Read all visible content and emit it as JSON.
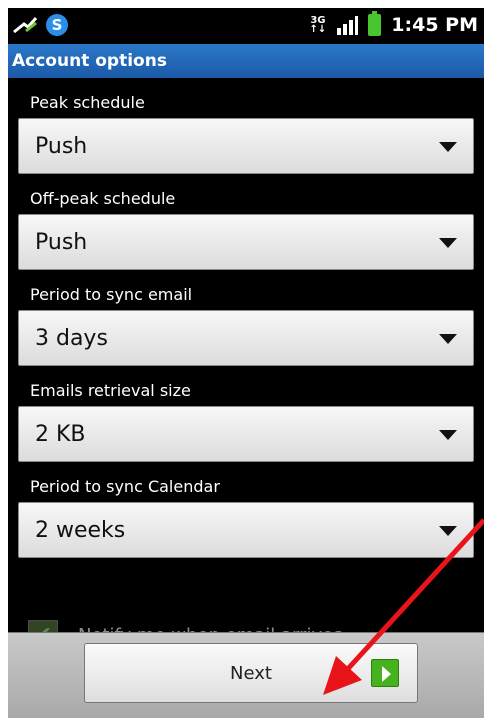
{
  "status_bar": {
    "time": "1:45 PM",
    "network_label": "3G",
    "icons": [
      "usb-debug-icon",
      "skype-icon",
      "network-3g-icon",
      "signal-icon",
      "battery-icon"
    ],
    "skype_letter": "S"
  },
  "title_bar": {
    "title": "Account options"
  },
  "options": [
    {
      "label": "Peak schedule",
      "value": "Push"
    },
    {
      "label": "Off-peak schedule",
      "value": "Push"
    },
    {
      "label": "Period to sync email",
      "value": "3 days"
    },
    {
      "label": "Emails retrieval size",
      "value": "2 KB"
    },
    {
      "label": "Period to sync Calendar",
      "value": "2 weeks"
    }
  ],
  "notify_checkbox": {
    "label": "Notify me when email arrives",
    "checked": true
  },
  "bottom": {
    "next_label": "Next"
  },
  "colors": {
    "title_bar": "#1f63b4",
    "annotation_arrow": "#e8141a",
    "next_icon": "#46b21d"
  }
}
